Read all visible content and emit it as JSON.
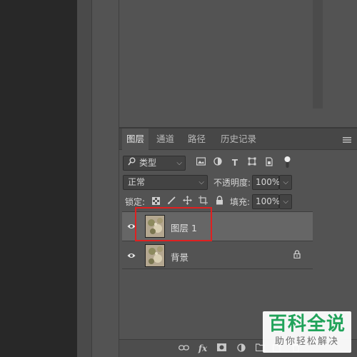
{
  "tabs": [
    {
      "label": "图层",
      "active": true
    },
    {
      "label": "通道",
      "active": false
    },
    {
      "label": "路径",
      "active": false
    },
    {
      "label": "历史记录",
      "active": false
    }
  ],
  "filter": {
    "selected": "类型"
  },
  "blend": {
    "mode": "正常",
    "opacity_label": "不透明度:",
    "opacity_value": "100%"
  },
  "lock": {
    "label": "锁定:",
    "fill_label": "填充:",
    "fill_value": "100%"
  },
  "layers": [
    {
      "name": "图层 1",
      "selected": true,
      "visible": true,
      "locked": false
    },
    {
      "name": "背景",
      "selected": false,
      "visible": true,
      "locked": true
    }
  ],
  "footer": {
    "fx_label": "fx"
  },
  "watermark": {
    "title": "百科全说",
    "subtitle": "助你轻松解决"
  },
  "colors": {
    "accent_highlight": "#e02020",
    "watermark_green": "#21a35a",
    "panel_bg": "#535353"
  }
}
